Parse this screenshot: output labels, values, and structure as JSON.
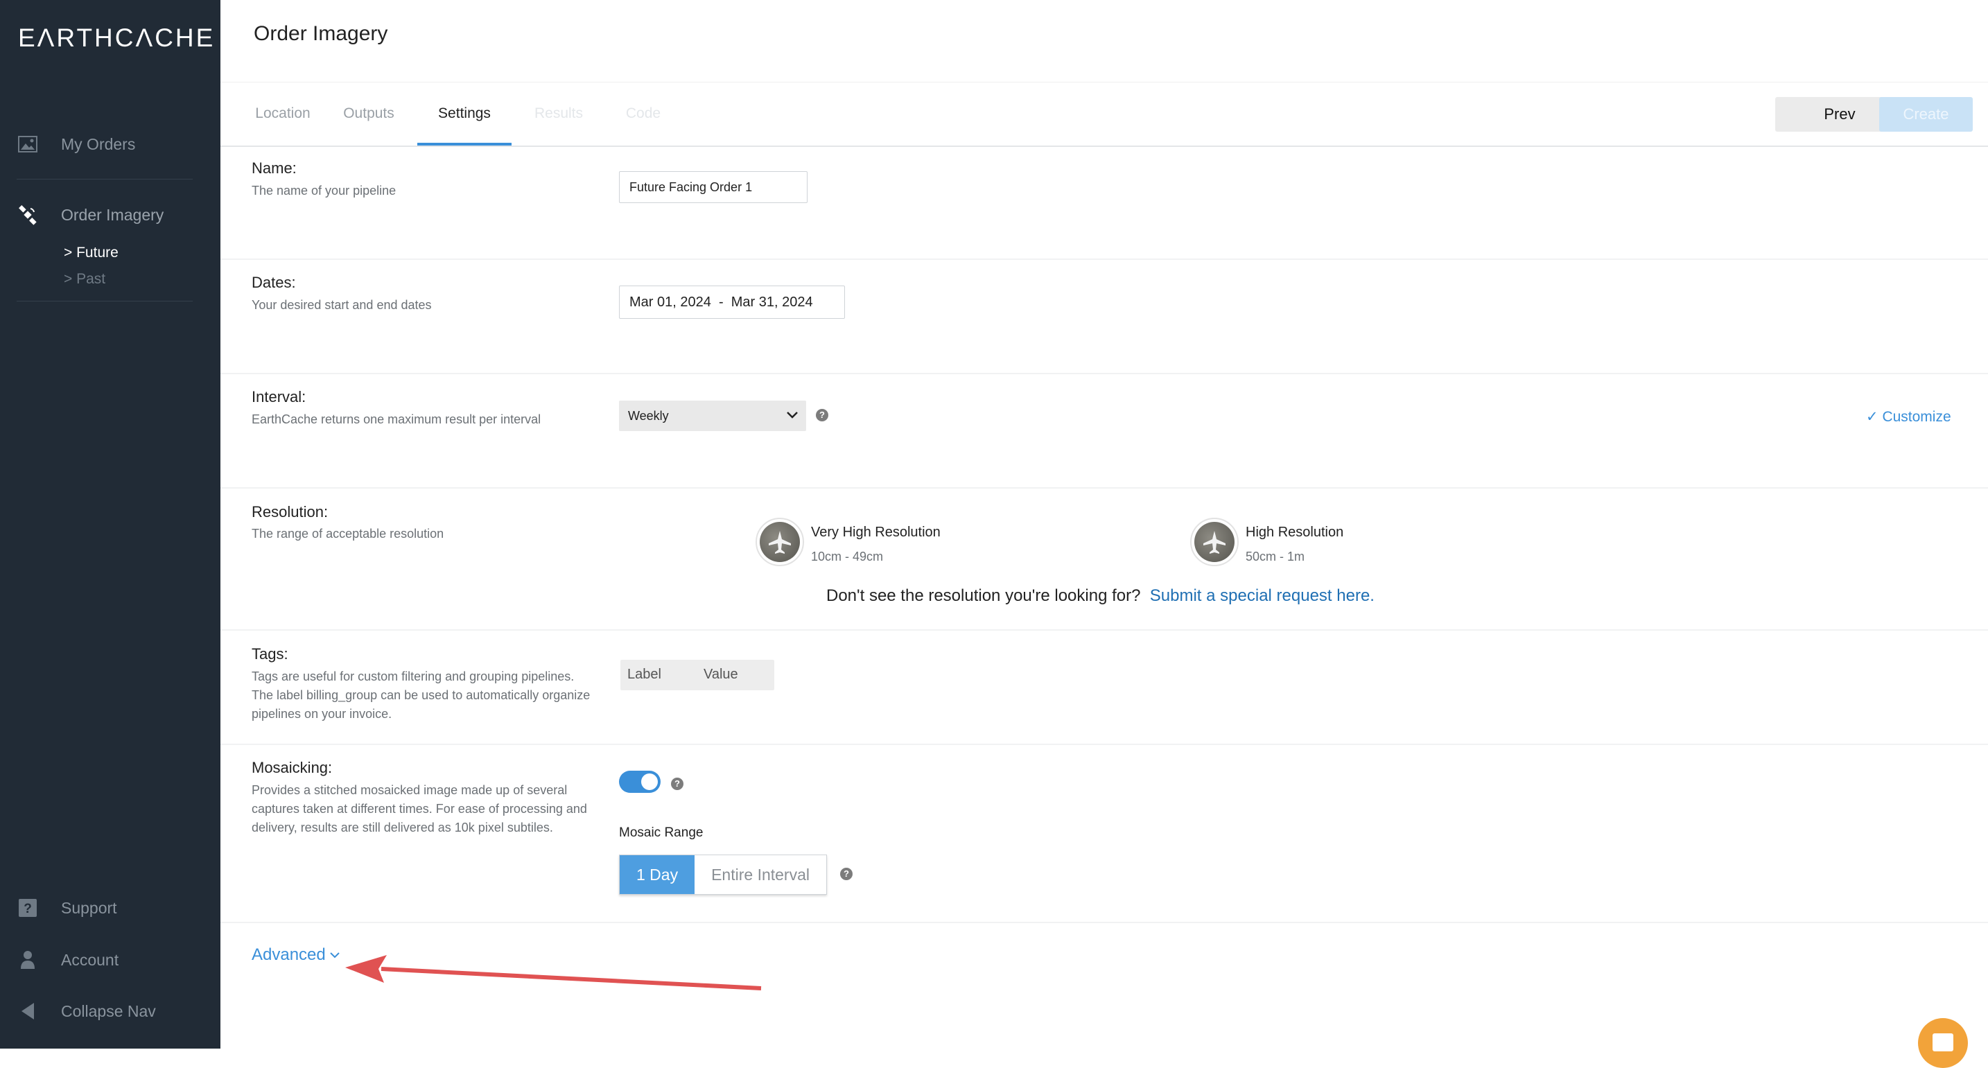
{
  "sidebar": {
    "logo": "EΛRTHCΛCHE",
    "items": [
      {
        "label": "My Orders",
        "icon": "image-icon"
      },
      {
        "label": "Order Imagery",
        "icon": "satellite-icon"
      }
    ],
    "sub_items": [
      {
        "label": "> Future",
        "active": true
      },
      {
        "label": "> Past",
        "active": false
      }
    ],
    "bottom_items": [
      {
        "label": "Support",
        "icon": "help-square-icon"
      },
      {
        "label": "Account",
        "icon": "person-icon"
      },
      {
        "label": "Collapse Nav",
        "icon": "triangle-left-icon"
      }
    ]
  },
  "header": {
    "title": "Order Imagery"
  },
  "tabs": [
    {
      "label": "Location",
      "state": "muted"
    },
    {
      "label": "Outputs",
      "state": "muted"
    },
    {
      "label": "Settings",
      "state": "active"
    },
    {
      "label": "Results",
      "state": "disabled"
    },
    {
      "label": "Code",
      "state": "disabled"
    }
  ],
  "actions": {
    "prev_label": "Prev",
    "create_label": "Create"
  },
  "fields": {
    "name": {
      "title": "Name:",
      "desc": "The name of your pipeline",
      "value": "Future Facing Order 1"
    },
    "dates": {
      "title": "Dates:",
      "desc": "Your desired start and end dates",
      "value": "Mar 01, 2024  -  Mar 31, 2024"
    },
    "interval": {
      "title": "Interval:",
      "desc": "EarthCache returns one maximum result per interval",
      "value": "Weekly",
      "help": "?",
      "customize_label": "Customize"
    },
    "resolution": {
      "title": "Resolution:",
      "desc": "The range of acceptable resolution",
      "options": [
        {
          "name": "Very High Resolution",
          "range": "10cm - 49cm"
        },
        {
          "name": "High Resolution",
          "range": "50cm - 1m"
        }
      ],
      "note_text": "Don't see the resolution you're looking for?",
      "note_link": "Submit a special request here."
    },
    "tags": {
      "title": "Tags:",
      "desc": "Tags are useful for custom filtering and grouping pipelines. The label billing_group can be used to automatically organize pipelines on your invoice.",
      "label_placeholder": "Label",
      "value_placeholder": "Value"
    },
    "mosaicking": {
      "title": "Mosaicking:",
      "desc": "Provides a stitched mosaicked image made up of several captures taken at different times. For ease of processing and delivery, results are still delivered as 10k pixel subtiles.",
      "enabled": true,
      "help": "?",
      "range_label": "Mosaic Range",
      "range_options": [
        "1 Day",
        "Entire Interval"
      ],
      "range_selected": "1 Day",
      "range_help": "?"
    }
  },
  "advanced": {
    "label": "Advanced"
  },
  "colors": {
    "sidebar_bg": "#212b36",
    "accent": "#3a8fd9",
    "annotation_arrow": "#e05252",
    "chat_button": "#f2a33a"
  }
}
